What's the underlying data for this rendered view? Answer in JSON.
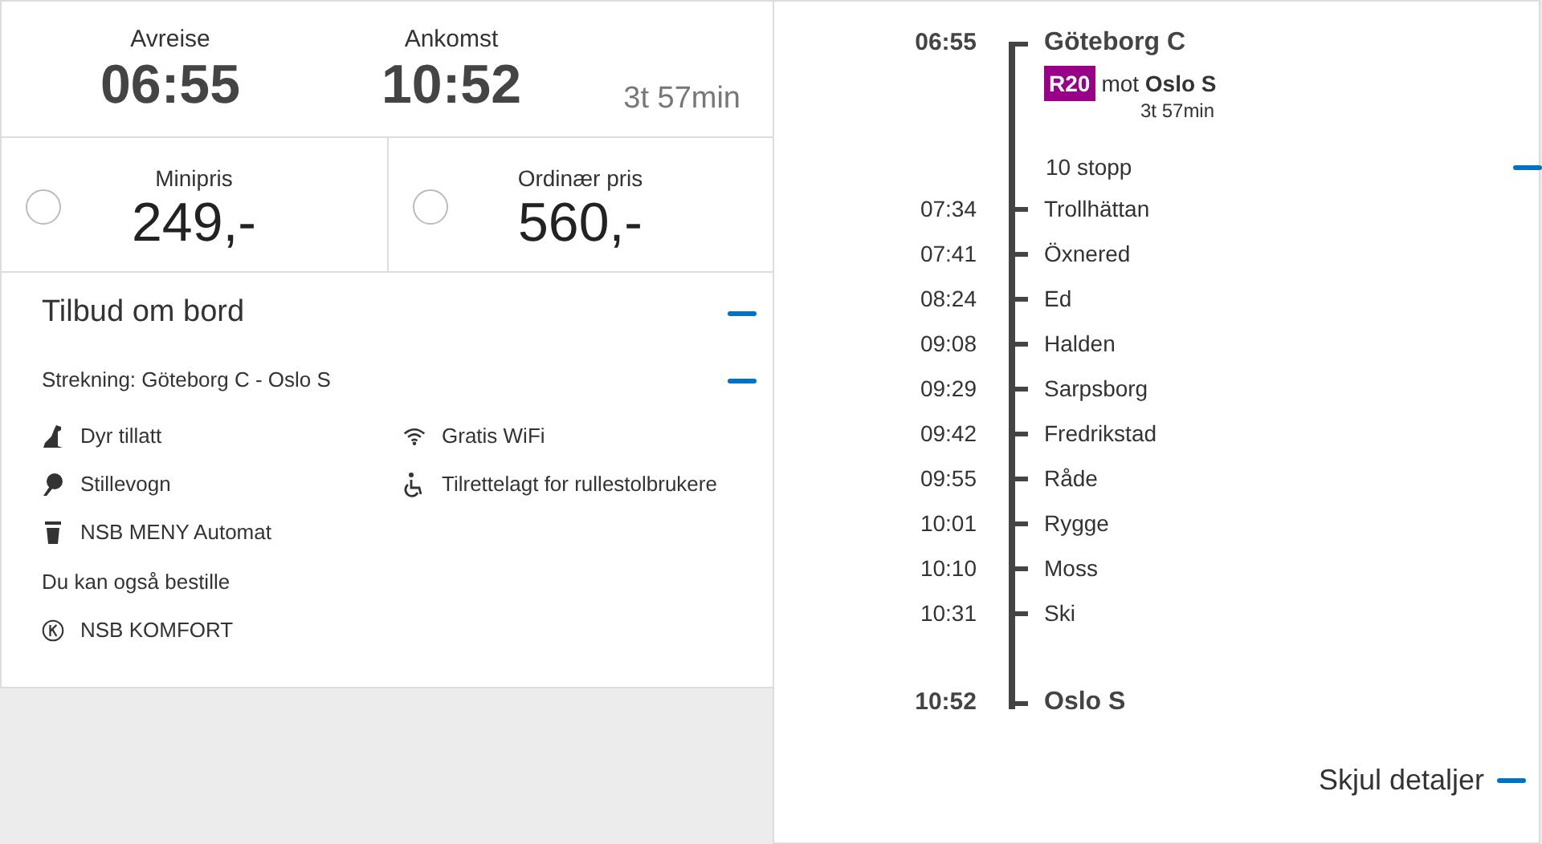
{
  "journey": {
    "departure_label": "Avreise",
    "departure_time": "06:55",
    "arrival_label": "Ankomst",
    "arrival_time": "10:52",
    "duration": "3t 57min"
  },
  "prices": [
    {
      "label": "Minipris",
      "amount": "249,-",
      "selected": false
    },
    {
      "label": "Ordinær pris",
      "amount": "560,-",
      "selected": false
    }
  ],
  "onboard": {
    "title": "Tilbud om bord",
    "expanded": true,
    "route": "Strekning: Göteborg C - Oslo S",
    "route_expanded": true,
    "facilities": [
      {
        "kind": "dog",
        "label": "Dyr tillatt"
      },
      {
        "kind": "wifi",
        "label": "Gratis WiFi"
      },
      {
        "kind": "quiet",
        "label": "Stillevogn"
      },
      {
        "kind": "wheelchair",
        "label": "Tilrettelagt for rullestolbrukere"
      },
      {
        "kind": "cup",
        "label": "NSB MENY Automat"
      }
    ],
    "extra_title": "Du kan også bestille",
    "extras": [
      {
        "kind": "komfort",
        "label": "NSB KOMFORT"
      }
    ]
  },
  "timeline": {
    "origin": {
      "time": "06:55",
      "station": "Göteborg C"
    },
    "line": {
      "badge": "R20",
      "color": "#990088",
      "direction": "mot **Oslo S**",
      "duration": "3t 57min"
    },
    "stops_label": "10 stopp",
    "stops_expanded": true,
    "stops": [
      {
        "time": "07:34",
        "station": "Trollhättan"
      },
      {
        "time": "07:41",
        "station": "Öxnered"
      },
      {
        "time": "08:24",
        "station": "Ed"
      },
      {
        "time": "09:08",
        "station": "Halden"
      },
      {
        "time": "09:29",
        "station": "Sarpsborg"
      },
      {
        "time": "09:42",
        "station": "Fredrikstad"
      },
      {
        "time": "09:55",
        "station": "Råde"
      },
      {
        "time": "10:01",
        "station": "Rygge"
      },
      {
        "time": "10:10",
        "station": "Moss"
      },
      {
        "time": "10:31",
        "station": "Ski"
      }
    ],
    "destination": {
      "time": "10:52",
      "station": "Oslo S"
    },
    "hide_details": "Skjul detaljer"
  }
}
